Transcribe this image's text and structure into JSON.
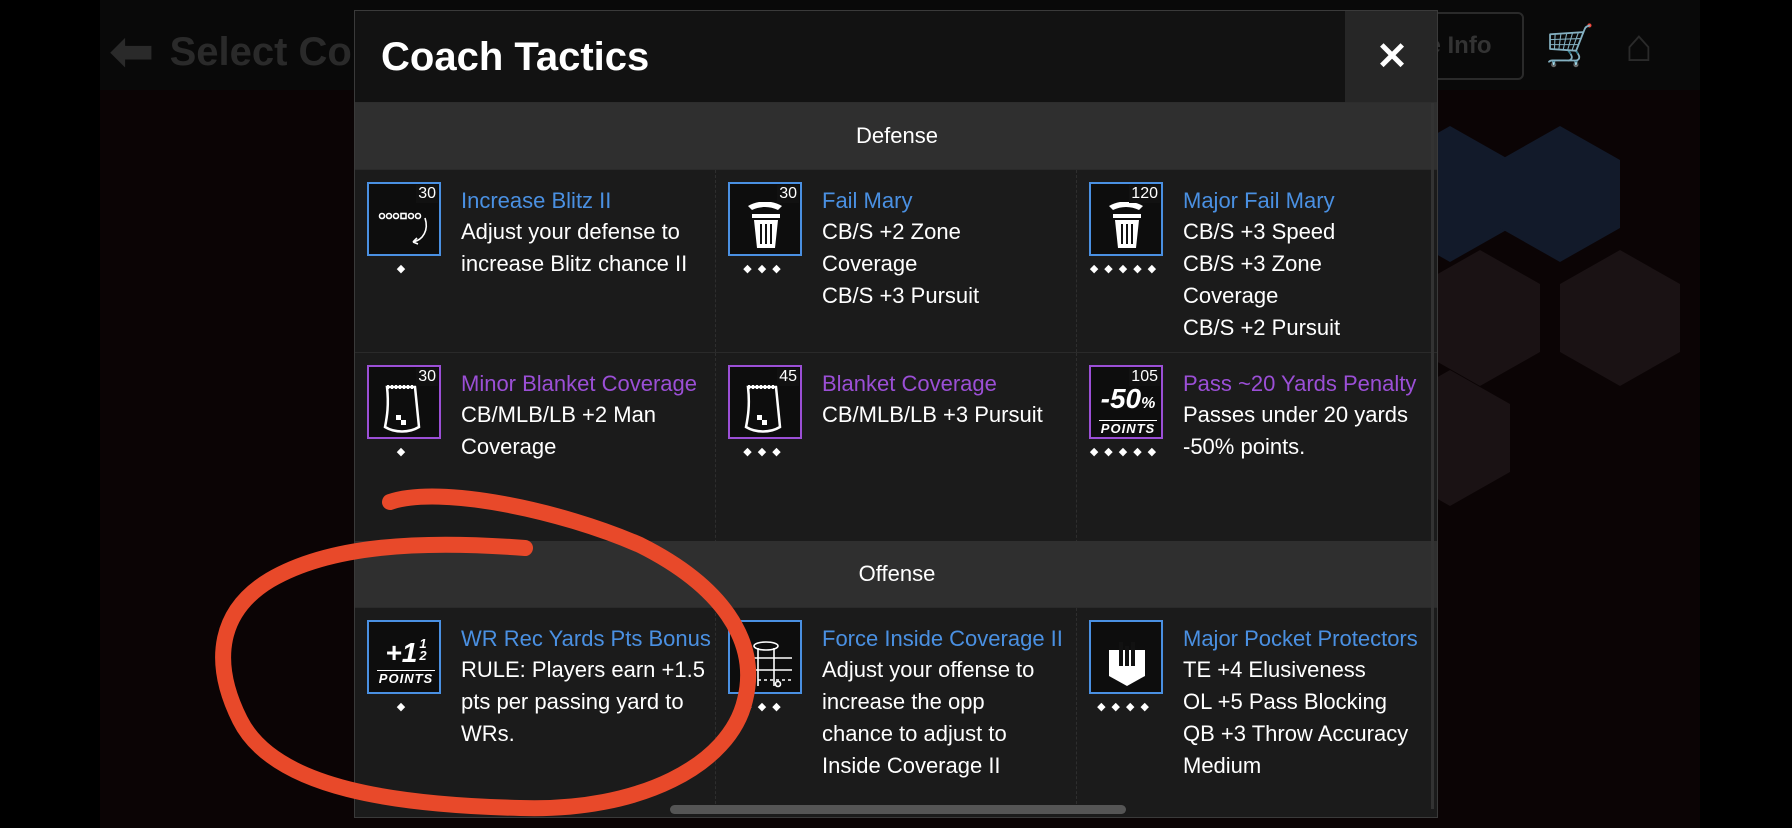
{
  "background": {
    "back_label": "Select Co",
    "info_label": "e Info"
  },
  "modal": {
    "title": "Coach Tactics",
    "close_symbol": "✕"
  },
  "sections": {
    "defense": {
      "label": "Defense",
      "rows": [
        [
          {
            "title": "Increase Blitz II",
            "count": "30",
            "color": "blue",
            "icon": "blitz-play-icon",
            "dots": "◆",
            "desc": [
              "Adjust your defense to",
              "increase Blitz chance II"
            ]
          },
          {
            "title": "Fail Mary",
            "count": "30",
            "color": "blue",
            "icon": "trash-can-icon",
            "dots": "◆◆◆",
            "desc": [
              "CB/S +2 Zone",
              "Coverage",
              "CB/S +3 Pursuit"
            ]
          },
          {
            "title": "Major Fail Mary",
            "count": "120",
            "color": "blue",
            "icon": "trash-can-icon",
            "dots": "◆◆◆◆◆",
            "desc": [
              "CB/S +3 Speed",
              "CB/S +3 Zone",
              "Coverage",
              "CB/S +2 Pursuit"
            ]
          }
        ],
        [
          {
            "title": "Minor Blanket Coverage",
            "count": "30",
            "color": "purple",
            "icon": "blanket-icon",
            "dots": "◆",
            "desc": [
              "CB/MLB/LB +2 Man",
              "Coverage"
            ]
          },
          {
            "title": "Blanket Coverage",
            "count": "45",
            "color": "purple",
            "icon": "blanket-icon",
            "dots": "◆◆◆",
            "desc": [
              "CB/MLB/LB +3 Pursuit"
            ]
          },
          {
            "title": "Pass ~20 Yards Penalty",
            "count": "105",
            "color": "purple",
            "icon": "minus-50-points-icon",
            "icon_big": "-50",
            "icon_pct": "%",
            "icon_small": "POINTS",
            "dots": "◆◆◆◆◆",
            "desc": [
              "Passes under 20 yards",
              "-50% points."
            ]
          }
        ]
      ]
    },
    "offense": {
      "label": "Offense",
      "rows": [
        [
          {
            "title": "WR Rec Yards Pts Bonus",
            "count": "",
            "color": "blue",
            "icon": "plus-points-icon",
            "icon_big": "+1",
            "icon_frac_top": "1",
            "icon_frac_bot": "2",
            "icon_small": "POINTS",
            "dots": "◆",
            "desc": [
              "RULE: Players earn +1.5",
              "pts per passing yard to",
              "WRs."
            ]
          },
          {
            "title": "Force Inside Coverage II",
            "count": "",
            "color": "blue",
            "icon": "coverage-field-icon",
            "dots": "◆◆◆",
            "desc": [
              "Adjust your offense to",
              "increase the opp",
              "chance to adjust to",
              "Inside Coverage II"
            ]
          },
          {
            "title": "Major Pocket Protectors",
            "count": "",
            "color": "blue",
            "icon": "pocket-protector-icon",
            "dots": "◆◆◆◆",
            "desc": [
              "TE +4 Elusiveness",
              "OL +5 Pass Blocking",
              "QB +3 Throw Accuracy",
              "Medium"
            ]
          }
        ]
      ]
    }
  },
  "colors": {
    "blue": "#4a90e2",
    "purple": "#9b4fd6",
    "annotation": "#e8492a"
  }
}
